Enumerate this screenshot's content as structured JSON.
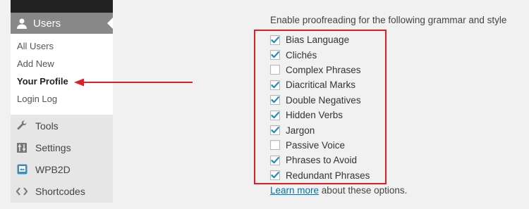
{
  "sidebar": {
    "current_menu": {
      "label": "Users",
      "icon": "user-icon"
    },
    "submenu": [
      {
        "label": "All Users",
        "current": false
      },
      {
        "label": "Add New",
        "current": false
      },
      {
        "label": "Your Profile",
        "current": true
      },
      {
        "label": "Login Log",
        "current": false
      }
    ],
    "menu": [
      {
        "label": "Tools",
        "icon": "wrench-icon"
      },
      {
        "label": "Settings",
        "icon": "settings-icon"
      },
      {
        "label": "WPB2D",
        "icon": "wpb2d-icon"
      },
      {
        "label": "Shortcodes",
        "icon": "code-icon"
      }
    ]
  },
  "proofreading": {
    "intro": "Enable proofreading for the following grammar and style",
    "options": [
      {
        "label": "Bias Language",
        "checked": true
      },
      {
        "label": "Clichés",
        "checked": true
      },
      {
        "label": "Complex Phrases",
        "checked": false
      },
      {
        "label": "Diacritical Marks",
        "checked": true
      },
      {
        "label": "Double Negatives",
        "checked": true
      },
      {
        "label": "Hidden Verbs",
        "checked": true
      },
      {
        "label": "Jargon",
        "checked": true
      },
      {
        "label": "Passive Voice",
        "checked": false
      },
      {
        "label": "Phrases to Avoid",
        "checked": true
      },
      {
        "label": "Redundant Phrases",
        "checked": true
      }
    ],
    "learn_more_link": "Learn more",
    "learn_more_suffix": " about these options."
  },
  "colors": {
    "annotation_red": "#dd1f26",
    "checkmark": "#1e8cbe",
    "link": "#0073aa"
  }
}
